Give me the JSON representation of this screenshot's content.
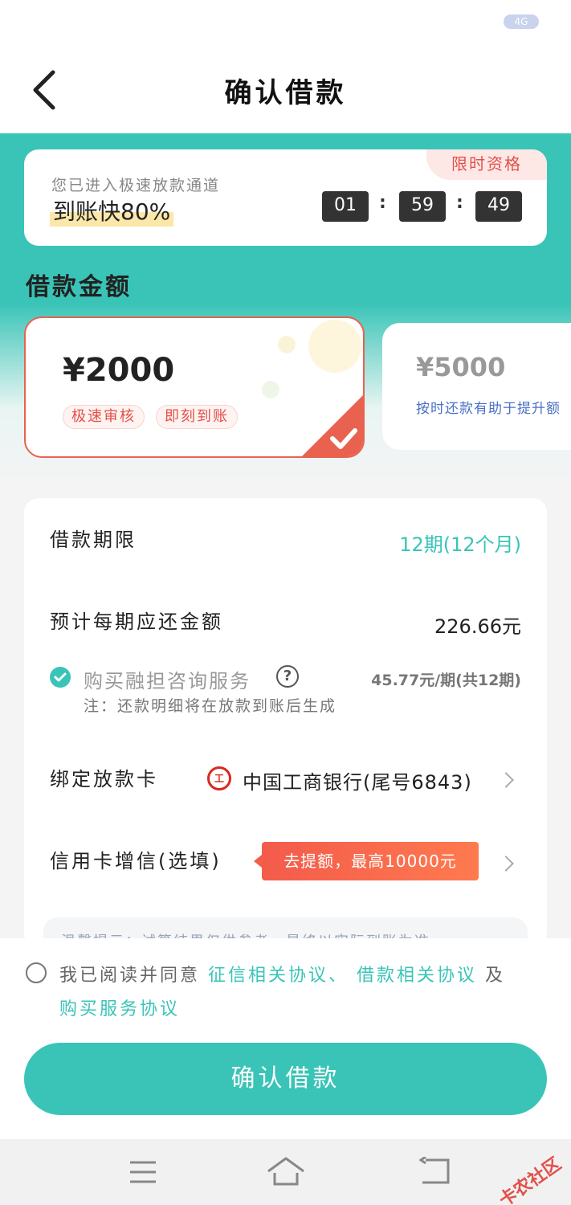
{
  "status": {
    "signal_badge": "4G"
  },
  "header": {
    "title": "确认借款",
    "back_icon": "chevron-left-icon"
  },
  "promo": {
    "tag": "限时资格",
    "subtitle": "您已进入极速放款通道",
    "headline": "到账快80%",
    "timer": {
      "hours": "01",
      "minutes": "59",
      "seconds": "49",
      "separator": ":"
    }
  },
  "amount": {
    "section_title": "借款金额",
    "options": [
      {
        "value": "¥2000",
        "chips": [
          "极速审核",
          "即刻到账"
        ],
        "selected": true
      },
      {
        "value": "¥5000",
        "tip": "按时还款有助于提升额",
        "selected": false
      }
    ]
  },
  "form": {
    "term": {
      "label": "借款期限",
      "value": "12期(12个月)"
    },
    "repayment": {
      "label": "预计每期应还金额",
      "value": "226.66元"
    },
    "service": {
      "checked": true,
      "label": "购买融担咨询服务",
      "help": "?",
      "fee": "45.77元/期(共12期)",
      "note": "注：还款明细将在放款到账后生成"
    },
    "card": {
      "label": "绑定放款卡",
      "bank_badge": "工",
      "bank": "中国工商银行(尾号6843)"
    },
    "credit": {
      "label": "信用卡增信(选填)",
      "button": "去提额，最高10000元"
    },
    "tip": "温馨提示：试算结果仅供参考，最终以实际到账为准"
  },
  "agreement": {
    "checked": false,
    "prefix": "我已阅读并同意",
    "link1": "征信相关协议、",
    "link2": "借款相关协议",
    "conj": "及",
    "link3": "购买服务协议"
  },
  "confirm_button": "确认借款",
  "watermark": "卡农社区",
  "colors": {
    "accent": "#39c4b7",
    "danger": "#e2504a",
    "highlight": "#fbe7a8"
  }
}
